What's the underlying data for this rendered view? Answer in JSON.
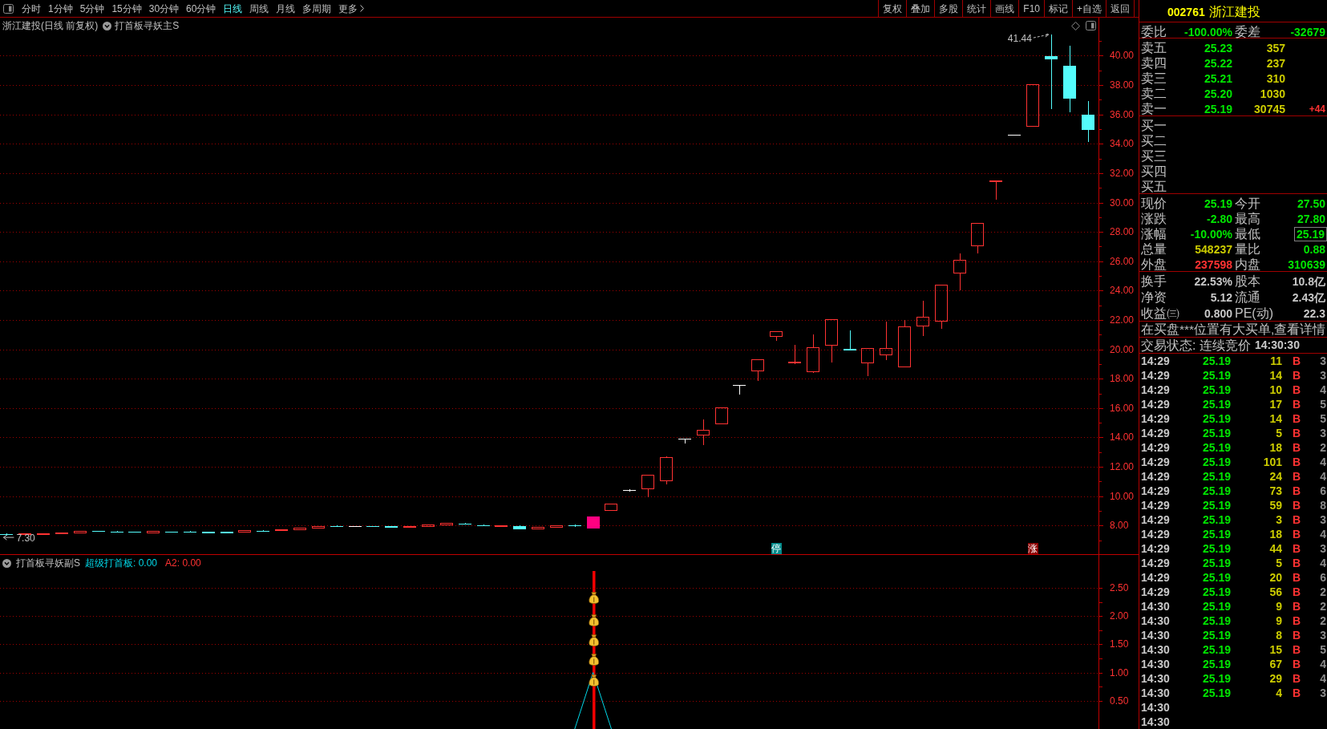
{
  "toolbar": {
    "periods": [
      {
        "label": "分时",
        "selected": false
      },
      {
        "label": "1分钟",
        "selected": false
      },
      {
        "label": "5分钟",
        "selected": false
      },
      {
        "label": "15分钟",
        "selected": false
      },
      {
        "label": "30分钟",
        "selected": false
      },
      {
        "label": "60分钟",
        "selected": false
      },
      {
        "label": "日线",
        "selected": true
      },
      {
        "label": "周线",
        "selected": false
      },
      {
        "label": "月线",
        "selected": false
      },
      {
        "label": "多周期",
        "selected": false
      }
    ],
    "more": "更多",
    "buttons": [
      "复权",
      "叠加",
      "多股",
      "统计",
      "画线",
      "F10",
      "标记",
      "+自选",
      "返回"
    ]
  },
  "main_chart": {
    "title": "浙江建投(日线 前复权)",
    "indicator": "打首板寻妖主S",
    "price_axis": [
      "40.00",
      "38.00",
      "36.00",
      "34.00",
      "32.00",
      "30.00",
      "28.00",
      "26.00",
      "24.00",
      "22.00",
      "20.00",
      "18.00",
      "16.00",
      "14.00",
      "12.00",
      "10.00",
      "8.00"
    ],
    "high_label": "41.44",
    "low_label": "7.30",
    "tags": [
      {
        "text": "停",
        "color": "#008b8b"
      },
      {
        "text": "涨",
        "color": "#8b0000"
      }
    ]
  },
  "sub_chart": {
    "title": "打首板寻妖副S",
    "legend": [
      {
        "text": "超级打首板: 0.00",
        "color": "#00d8e8"
      },
      {
        "text": "A2: 0.00",
        "color": "#ff3232"
      }
    ],
    "chart_data": {
      "type": "line",
      "grid": true,
      "ylim": [
        0,
        2.8
      ],
      "yticks": [
        {
          "value": 0.5,
          "label": "0.50"
        },
        {
          "value": 1,
          "label": "1.00"
        },
        {
          "value": 1.5,
          "label": "1.50"
        },
        {
          "value": 2,
          "label": "2.00"
        },
        {
          "value": 2.5,
          "label": "2.50"
        }
      ],
      "series": [
        {
          "color": "#00d8e8",
          "values": [
            null,
            null,
            null,
            null,
            null,
            null,
            null,
            null,
            null,
            null,
            null,
            null,
            null,
            null,
            null,
            null,
            null,
            null,
            null,
            null,
            null,
            null,
            null,
            null,
            null,
            null,
            null,
            null,
            null,
            null,
            null,
            0,
            1,
            0,
            null,
            null,
            null,
            null,
            null,
            null,
            null,
            null,
            null,
            null,
            null,
            null,
            null,
            null,
            null,
            null,
            null,
            null,
            null,
            null,
            null,
            null,
            null,
            null,
            null,
            null
          ]
        }
      ]
    }
  },
  "quote_panel": {
    "code": "002761",
    "name": "浙江建投",
    "order_ratio": [
      {
        "label": "委比",
        "value": "-100.00%"
      },
      {
        "label": "委差",
        "value": "-32679"
      }
    ],
    "asks": [
      {
        "label": "卖五",
        "price": "25.23",
        "volume": "357"
      },
      {
        "label": "卖四",
        "price": "25.22",
        "volume": "237"
      },
      {
        "label": "卖三",
        "price": "25.21",
        "volume": "310"
      },
      {
        "label": "卖二",
        "price": "25.20",
        "volume": "1030"
      },
      {
        "label": "卖一",
        "price": "25.19",
        "volume": "30745",
        "change": "+44"
      }
    ],
    "bids": [
      {
        "label": "买一"
      },
      {
        "label": "买二"
      },
      {
        "label": "买三"
      },
      {
        "label": "买四"
      },
      {
        "label": "买五"
      }
    ],
    "stats": [
      {
        "label": "现价",
        "value": "25.19",
        "color": "#00e600",
        "boxed": false
      },
      {
        "label": "今开",
        "value": "27.50",
        "color": "#00e600",
        "boxed": false
      },
      {
        "label": "涨跌",
        "value": "-2.80",
        "color": "#00e600",
        "boxed": false
      },
      {
        "label": "最高",
        "value": "27.80",
        "color": "#00e600",
        "boxed": false
      },
      {
        "label": "涨幅",
        "value": "-10.00%",
        "color": "#00e600",
        "boxed": false
      },
      {
        "label": "最低",
        "value": "25.19",
        "color": "#00e600",
        "boxed": true
      },
      {
        "label": "总量",
        "value": "548237",
        "color": "#cccc00",
        "boxed": false
      },
      {
        "label": "量比",
        "value": "0.88",
        "color": "#00e600",
        "boxed": false
      },
      {
        "label": "外盘",
        "value": "237598",
        "color": "#ff3232",
        "boxed": false
      },
      {
        "label": "内盘",
        "value": "310639",
        "color": "#00e600",
        "boxed": false
      }
    ],
    "fundamentals": [
      {
        "label": "换手",
        "value": "22.53%"
      },
      {
        "label": "股本",
        "value": "10.8亿"
      },
      {
        "label": "净资",
        "value": "5.12"
      },
      {
        "label": "流通",
        "value": "2.43亿"
      },
      {
        "label": "收益㈢",
        "value": "0.800"
      },
      {
        "label": "PE(动)",
        "value": "22.3"
      }
    ],
    "notice": "在买盘***位置有大买单,查看详情",
    "trading_status": {
      "label": "交易状态: 连续竞价",
      "time": "14:30:30"
    },
    "trades": [
      {
        "time": "14:29",
        "price": "25.19",
        "volume": "11",
        "side": "B",
        "column_5": "3"
      },
      {
        "time": "14:29",
        "price": "25.19",
        "volume": "14",
        "side": "B",
        "column_5": "3"
      },
      {
        "time": "14:29",
        "price": "25.19",
        "volume": "10",
        "side": "B",
        "column_5": "4"
      },
      {
        "time": "14:29",
        "price": "25.19",
        "volume": "17",
        "side": "B",
        "column_5": "5"
      },
      {
        "time": "14:29",
        "price": "25.19",
        "volume": "14",
        "side": "B",
        "column_5": "5"
      },
      {
        "time": "14:29",
        "price": "25.19",
        "volume": "5",
        "side": "B",
        "column_5": "3"
      },
      {
        "time": "14:29",
        "price": "25.19",
        "volume": "18",
        "side": "B",
        "column_5": "2"
      },
      {
        "time": "14:29",
        "price": "25.19",
        "volume": "101",
        "side": "B",
        "column_5": "4"
      },
      {
        "time": "14:29",
        "price": "25.19",
        "volume": "24",
        "side": "B",
        "column_5": "4"
      },
      {
        "time": "14:29",
        "price": "25.19",
        "volume": "73",
        "side": "B",
        "column_5": "6"
      },
      {
        "time": "14:29",
        "price": "25.19",
        "volume": "59",
        "side": "B",
        "column_5": "8"
      },
      {
        "time": "14:29",
        "price": "25.19",
        "volume": "3",
        "side": "B",
        "column_5": "3"
      },
      {
        "time": "14:29",
        "price": "25.19",
        "volume": "18",
        "side": "B",
        "column_5": "4"
      },
      {
        "time": "14:29",
        "price": "25.19",
        "volume": "44",
        "side": "B",
        "column_5": "3"
      },
      {
        "time": "14:29",
        "price": "25.19",
        "volume": "5",
        "side": "B",
        "column_5": "4"
      },
      {
        "time": "14:29",
        "price": "25.19",
        "volume": "20",
        "side": "B",
        "column_5": "6"
      },
      {
        "time": "14:29",
        "price": "25.19",
        "volume": "56",
        "side": "B",
        "column_5": "2"
      },
      {
        "time": "14:30",
        "price": "25.19",
        "volume": "9",
        "side": "B",
        "column_5": "2"
      },
      {
        "time": "14:30",
        "price": "25.19",
        "volume": "9",
        "side": "B",
        "column_5": "2"
      },
      {
        "time": "14:30",
        "price": "25.19",
        "volume": "8",
        "side": "B",
        "column_5": "3"
      },
      {
        "time": "14:30",
        "price": "25.19",
        "volume": "15",
        "side": "B",
        "column_5": "5"
      },
      {
        "time": "14:30",
        "price": "25.19",
        "volume": "67",
        "side": "B",
        "column_5": "4"
      },
      {
        "time": "14:30",
        "price": "25.19",
        "volume": "29",
        "side": "B",
        "column_5": "4"
      },
      {
        "time": "14:30",
        "price": "25.19",
        "volume": "4",
        "side": "B",
        "column_5": "3"
      },
      {
        "time": "14:30"
      },
      {
        "time": "14:30"
      }
    ]
  }
}
